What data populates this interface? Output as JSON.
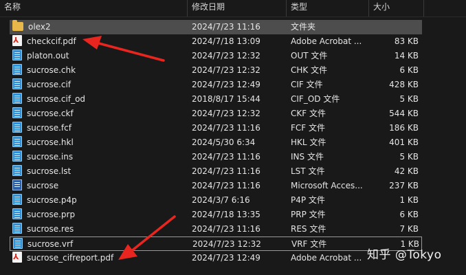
{
  "columns": {
    "name": "名称",
    "date": "修改日期",
    "type": "类型",
    "size": "大小"
  },
  "files": [
    {
      "name": "olex2",
      "date": "2024/7/23 11:16",
      "type": "文件夹",
      "size": "",
      "icon": "folder-icon"
    },
    {
      "name": "checkcif.pdf",
      "date": "2024/7/18 13:09",
      "type": "Adobe Acrobat ...",
      "size": "83 KB",
      "icon": "pdf-icon"
    },
    {
      "name": "platon.out",
      "date": "2024/7/23 12:32",
      "type": "OUT 文件",
      "size": "14 KB",
      "icon": "file-icon"
    },
    {
      "name": "sucrose.chk",
      "date": "2024/7/23 12:32",
      "type": "CHK 文件",
      "size": "6 KB",
      "icon": "file-icon"
    },
    {
      "name": "sucrose.cif",
      "date": "2024/7/23 12:49",
      "type": "CIF 文件",
      "size": "428 KB",
      "icon": "file-icon"
    },
    {
      "name": "sucrose.cif_od",
      "date": "2018/8/17 15:44",
      "type": "CIF_OD 文件",
      "size": "5 KB",
      "icon": "file-icon"
    },
    {
      "name": "sucrose.ckf",
      "date": "2024/7/23 12:32",
      "type": "CKF 文件",
      "size": "544 KB",
      "icon": "file-icon"
    },
    {
      "name": "sucrose.fcf",
      "date": "2024/7/23 11:16",
      "type": "FCF 文件",
      "size": "186 KB",
      "icon": "file-icon"
    },
    {
      "name": "sucrose.hkl",
      "date": "2024/5/30 6:34",
      "type": "HKL 文件",
      "size": "401 KB",
      "icon": "file-icon"
    },
    {
      "name": "sucrose.ins",
      "date": "2024/7/23 11:16",
      "type": "INS 文件",
      "size": "5 KB",
      "icon": "file-icon"
    },
    {
      "name": "sucrose.lst",
      "date": "2024/7/23 11:16",
      "type": "LST 文件",
      "size": "42 KB",
      "icon": "file-icon"
    },
    {
      "name": "sucrose",
      "date": "2024/7/23 11:16",
      "type": "Microsoft Acces...",
      "size": "237 KB",
      "icon": "database-icon"
    },
    {
      "name": "sucrose.p4p",
      "date": "2024/3/7 6:16",
      "type": "P4P 文件",
      "size": "1 KB",
      "icon": "file-icon"
    },
    {
      "name": "sucrose.prp",
      "date": "2024/7/18 13:35",
      "type": "PRP 文件",
      "size": "6 KB",
      "icon": "file-icon"
    },
    {
      "name": "sucrose.res",
      "date": "2024/7/23 11:16",
      "type": "RES 文件",
      "size": "7 KB",
      "icon": "file-icon"
    },
    {
      "name": "sucrose.vrf",
      "date": "2024/7/23 12:32",
      "type": "VRF 文件",
      "size": "1 KB",
      "icon": "file-icon"
    },
    {
      "name": "sucrose_cifreport.pdf",
      "date": "2024/7/23 12:49",
      "type": "Adobe Acrobat ...",
      "size": "",
      "icon": "pdf-icon"
    }
  ],
  "selected_row": 0,
  "focused_row": 15,
  "watermark": "知乎 @Tokyo",
  "annotation_color": "#e8261f"
}
